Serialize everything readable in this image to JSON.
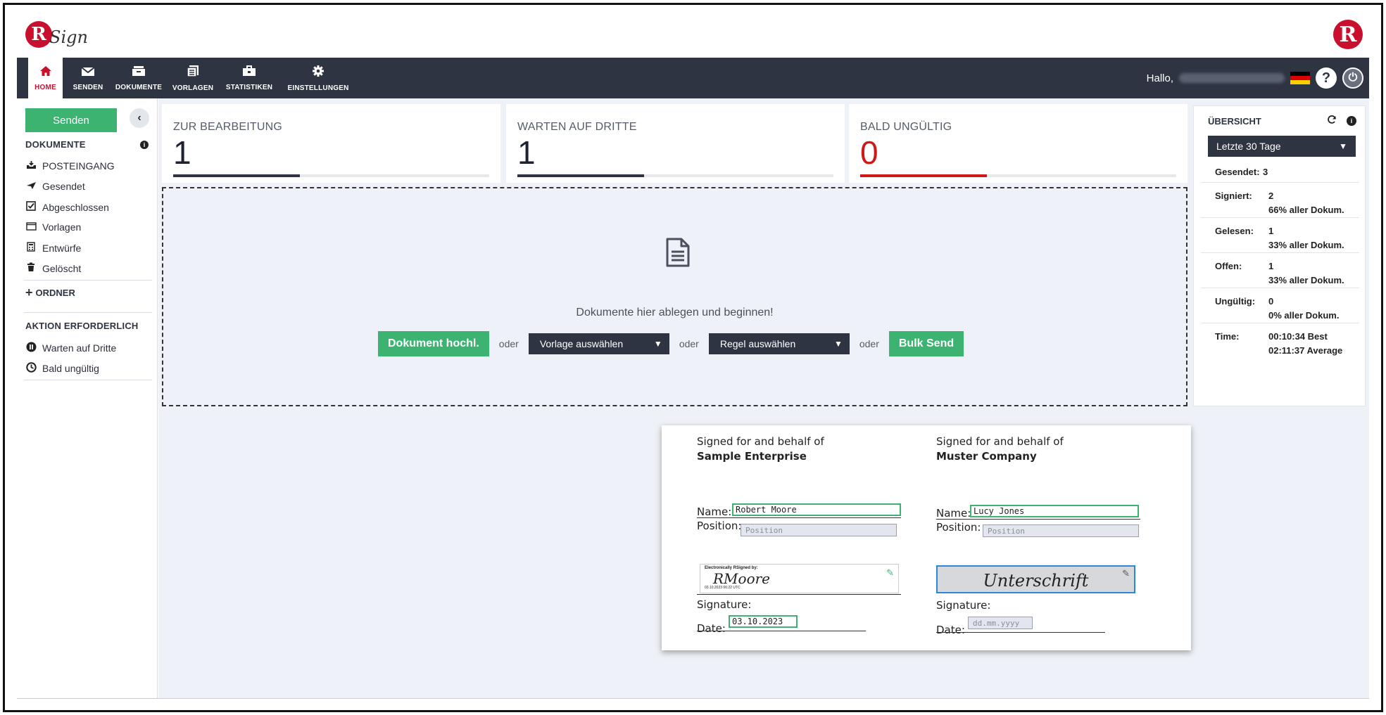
{
  "app": {
    "logo_letter": "R",
    "logo_suffix": "Sign",
    "brand_color": "#c8102e",
    "nav_bg": "#2e3442",
    "accent_green": "#3cb371"
  },
  "nav": {
    "items": [
      {
        "label": "HOME",
        "icon": "home-icon"
      },
      {
        "label": "SENDEN",
        "icon": "envelope-icon"
      },
      {
        "label": "DOKUMENTE",
        "icon": "archive-icon"
      },
      {
        "label": "VORLAGEN",
        "icon": "templates-icon"
      },
      {
        "label": "STATISTIKEN",
        "icon": "briefcase-icon"
      },
      {
        "label": "EINSTELLUNGEN",
        "icon": "gear-icon"
      }
    ],
    "active": "HOME",
    "greeting": "Hallo,",
    "help_glyph": "?",
    "power_glyph": "⏻"
  },
  "sidebar": {
    "send_label": "Senden",
    "collapse_glyph": "‹",
    "documents_heading": "DOKUMENTE",
    "documents": [
      {
        "label": "POSTEINGANG",
        "icon": "inbox-icon"
      },
      {
        "label": "Gesendet",
        "icon": "paper-plane-icon"
      },
      {
        "label": "Abgeschlossen",
        "icon": "checkbox-icon"
      },
      {
        "label": "Vorlagen",
        "icon": "window-icon"
      },
      {
        "label": "Entwürfe",
        "icon": "calculator-icon"
      },
      {
        "label": "Gelöscht",
        "icon": "trash-icon"
      }
    ],
    "folder_label": "ORDNER",
    "action_heading": "AKTION ERFORDERLICH",
    "actions": [
      {
        "label": "Warten auf Dritte",
        "icon": "pause-icon"
      },
      {
        "label": "Bald ungültig",
        "icon": "clock-icon"
      }
    ]
  },
  "stats": [
    {
      "label": "ZUR BEARBEITUNG",
      "value": "1",
      "fill_fraction": 0.4
    },
    {
      "label": "WARTEN AUF DRITTE",
      "value": "1",
      "fill_fraction": 0.4
    },
    {
      "label": "BALD UNGÜLTIG",
      "value": "0",
      "fill_fraction": 0.4
    }
  ],
  "dropzone": {
    "text": "Dokumente hier ablegen und beginnen!",
    "upload_label": "Dokument hochl.",
    "or_label": "oder",
    "template_select": "Vorlage auswählen",
    "rule_select": "Regel auswählen",
    "bulk_label": "Bulk Send"
  },
  "overview": {
    "title": "ÜBERSICHT",
    "period": "Letzte 30 Tage",
    "sent_label": "Gesendet:",
    "sent_value": "3",
    "rows": [
      {
        "key": "Signiert:",
        "count": "2",
        "percent": "66% aller Dokum."
      },
      {
        "key": "Gelesen:",
        "count": "1",
        "percent": "33% aller Dokum."
      },
      {
        "key": "Offen:",
        "count": "1",
        "percent": "33% aller Dokum."
      },
      {
        "key": "Ungültig:",
        "count": "0",
        "percent": "0% aller Dokum."
      }
    ],
    "time_label": "Time:",
    "time_best": "00:10:34 Best",
    "time_avg": "02:11:37 Average"
  },
  "signature_doc": {
    "left": {
      "line1": "Signed for and behalf of",
      "company": "Sample Enterprise",
      "name_label": "Name:",
      "name_value": "Robert Moore",
      "position_label": "Position:",
      "position_placeholder": "Position",
      "sig_caption": "Electronically RSigned by:",
      "sig_script": "RMoore",
      "sig_stamp": "03.10.2023 06:22 UTC",
      "signature_label": "Signature:",
      "date_label": "Date:",
      "date_value": "03.10.2023"
    },
    "right": {
      "line1": "Signed for and behalf of",
      "company": "Muster Company",
      "name_label": "Name:",
      "name_value": "Lucy Jones",
      "position_label": "Position:",
      "position_placeholder": "Position",
      "sig_placeholder": "Unterschrift",
      "signature_label": "Signature:",
      "date_label": "Date:",
      "date_placeholder": "dd.mm.yyyy"
    }
  }
}
